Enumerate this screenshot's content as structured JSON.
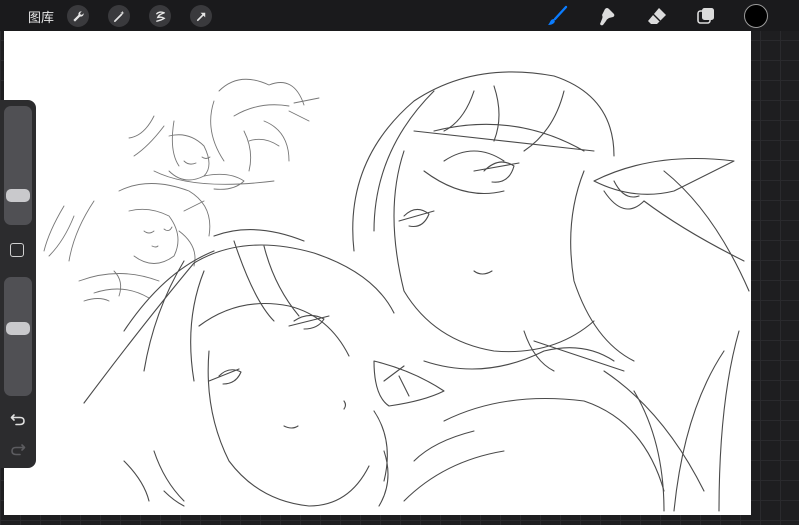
{
  "topbar": {
    "gallery_label": "图库",
    "left_tools": [
      "wrench-icon",
      "magic-wand-icon",
      "selection-icon",
      "transform-arrow-icon"
    ],
    "right_tools": [
      "brush-icon",
      "smudge-icon",
      "eraser-icon",
      "layers-icon"
    ],
    "active_tool": "brush-icon",
    "active_color": "#0a7cff",
    "current_color": "#000000"
  },
  "sidebar": {
    "brush_size_level": 0.22,
    "opacity_level": 0.58,
    "controls": [
      "brush-size-slider",
      "modify-button",
      "opacity-slider",
      "undo-button",
      "redo-button"
    ]
  },
  "canvas": {
    "background": "#ffffff",
    "content": "pencil-sketch"
  }
}
